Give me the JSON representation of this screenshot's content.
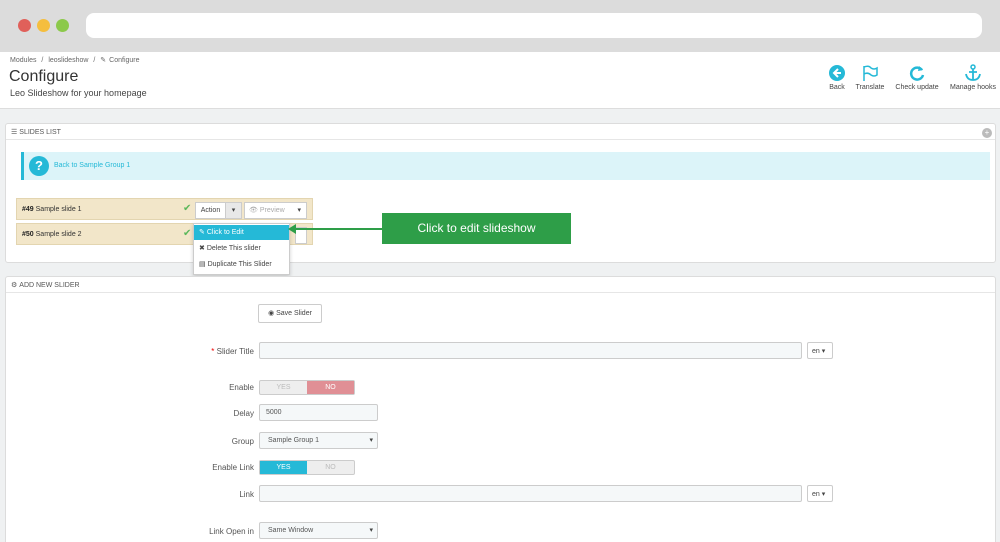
{
  "colors": {
    "accent": "#25b9d7",
    "callout": "#2e9e48",
    "slide_row": "#f2e6c9",
    "toggle_no": "#e08f95"
  },
  "breadcrumb": [
    "Modules",
    "/",
    "leoslideshow",
    "/",
    "Configure"
  ],
  "page": {
    "title": "Configure",
    "subtitle": "Leo Slideshow for your homepage"
  },
  "toolbar": [
    {
      "label": "Back",
      "icon": "back-icon"
    },
    {
      "label": "Translate",
      "icon": "flag-icon"
    },
    {
      "label": "Check update",
      "icon": "refresh-icon"
    },
    {
      "label": "Manage hooks",
      "icon": "anchor-icon"
    }
  ],
  "slides_list": {
    "heading": "SLIDES LIST",
    "info_link": "Back to Sample Group 1",
    "slides": [
      {
        "id": "#49",
        "name": "Sample slide 1"
      },
      {
        "id": "#50",
        "name": "Sample slide 2"
      }
    ],
    "action_label": "Action",
    "preview_label": "Preview",
    "dropdown": [
      "Click to Edit",
      "Delete This slider",
      "Duplicate This Slider"
    ]
  },
  "callout": "Click to edit slideshow",
  "add_slider": {
    "heading": "ADD NEW SLIDER",
    "save_label": "Save Slider",
    "slider_title_label": "Slider Title",
    "slider_title_value": "",
    "lang": "en",
    "enable_label": "Enable",
    "yes": "YES",
    "no": "NO",
    "enable_value": "NO",
    "delay_label": "Delay",
    "delay_value": "5000",
    "group_label": "Group",
    "group_value": "Sample Group 1",
    "enable_link_label": "Enable Link",
    "enable_link_value": "YES",
    "link_label": "Link",
    "link_value": "",
    "link_open_label": "Link Open in",
    "link_open_value": "Same Window"
  }
}
